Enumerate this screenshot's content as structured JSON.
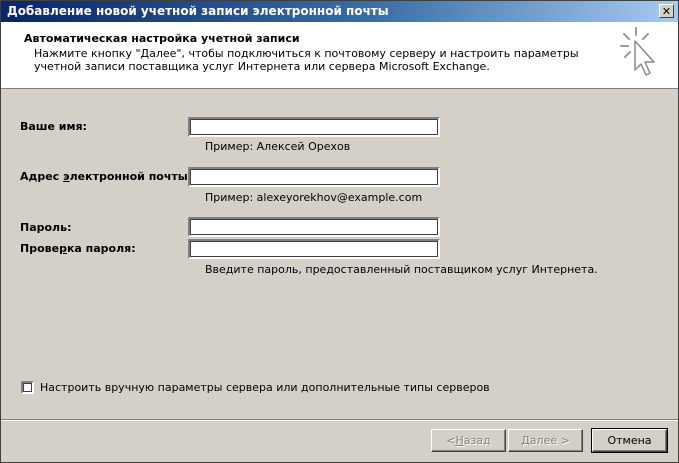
{
  "window": {
    "title": "Добавление новой учетной записи электронной почты",
    "close_symbol": "✕"
  },
  "header": {
    "title": "Автоматическая настройка учетной записи",
    "description": "Нажмите кнопку \"Далее\", чтобы подключиться к почтовому серверу и настроить параметры учетной записи поставщика услуг Интернета или сервера Microsoft Exchange.",
    "icon": "cursor-sparkle-icon"
  },
  "form": {
    "name": {
      "label_pre": "Ваше имя:",
      "value": "",
      "hint": "Пример: Алексей Орехов"
    },
    "email": {
      "label_pre": "Адрес ",
      "label_accel": "э",
      "label_post": "лектронной почты:",
      "value": "",
      "hint": "Пример: alexeyorekhov@example.com"
    },
    "password": {
      "label_pre": "Пароль:",
      "value": ""
    },
    "password_confirm": {
      "label_pre": "Прове",
      "label_accel": "р",
      "label_post": "ка пароля:",
      "value": "",
      "hint": "Введите пароль, предоставленный поставщиком услуг Интернета."
    },
    "manual": {
      "label": "Настроить вручную параметры сервера или дополнительные типы серверов",
      "checked": false
    }
  },
  "buttons": {
    "back_pre": "< ",
    "back_accel": "Н",
    "back_post": "азад",
    "next_pre": "",
    "next_accel": "Д",
    "next_post": "алее >",
    "cancel": "Отмена"
  }
}
